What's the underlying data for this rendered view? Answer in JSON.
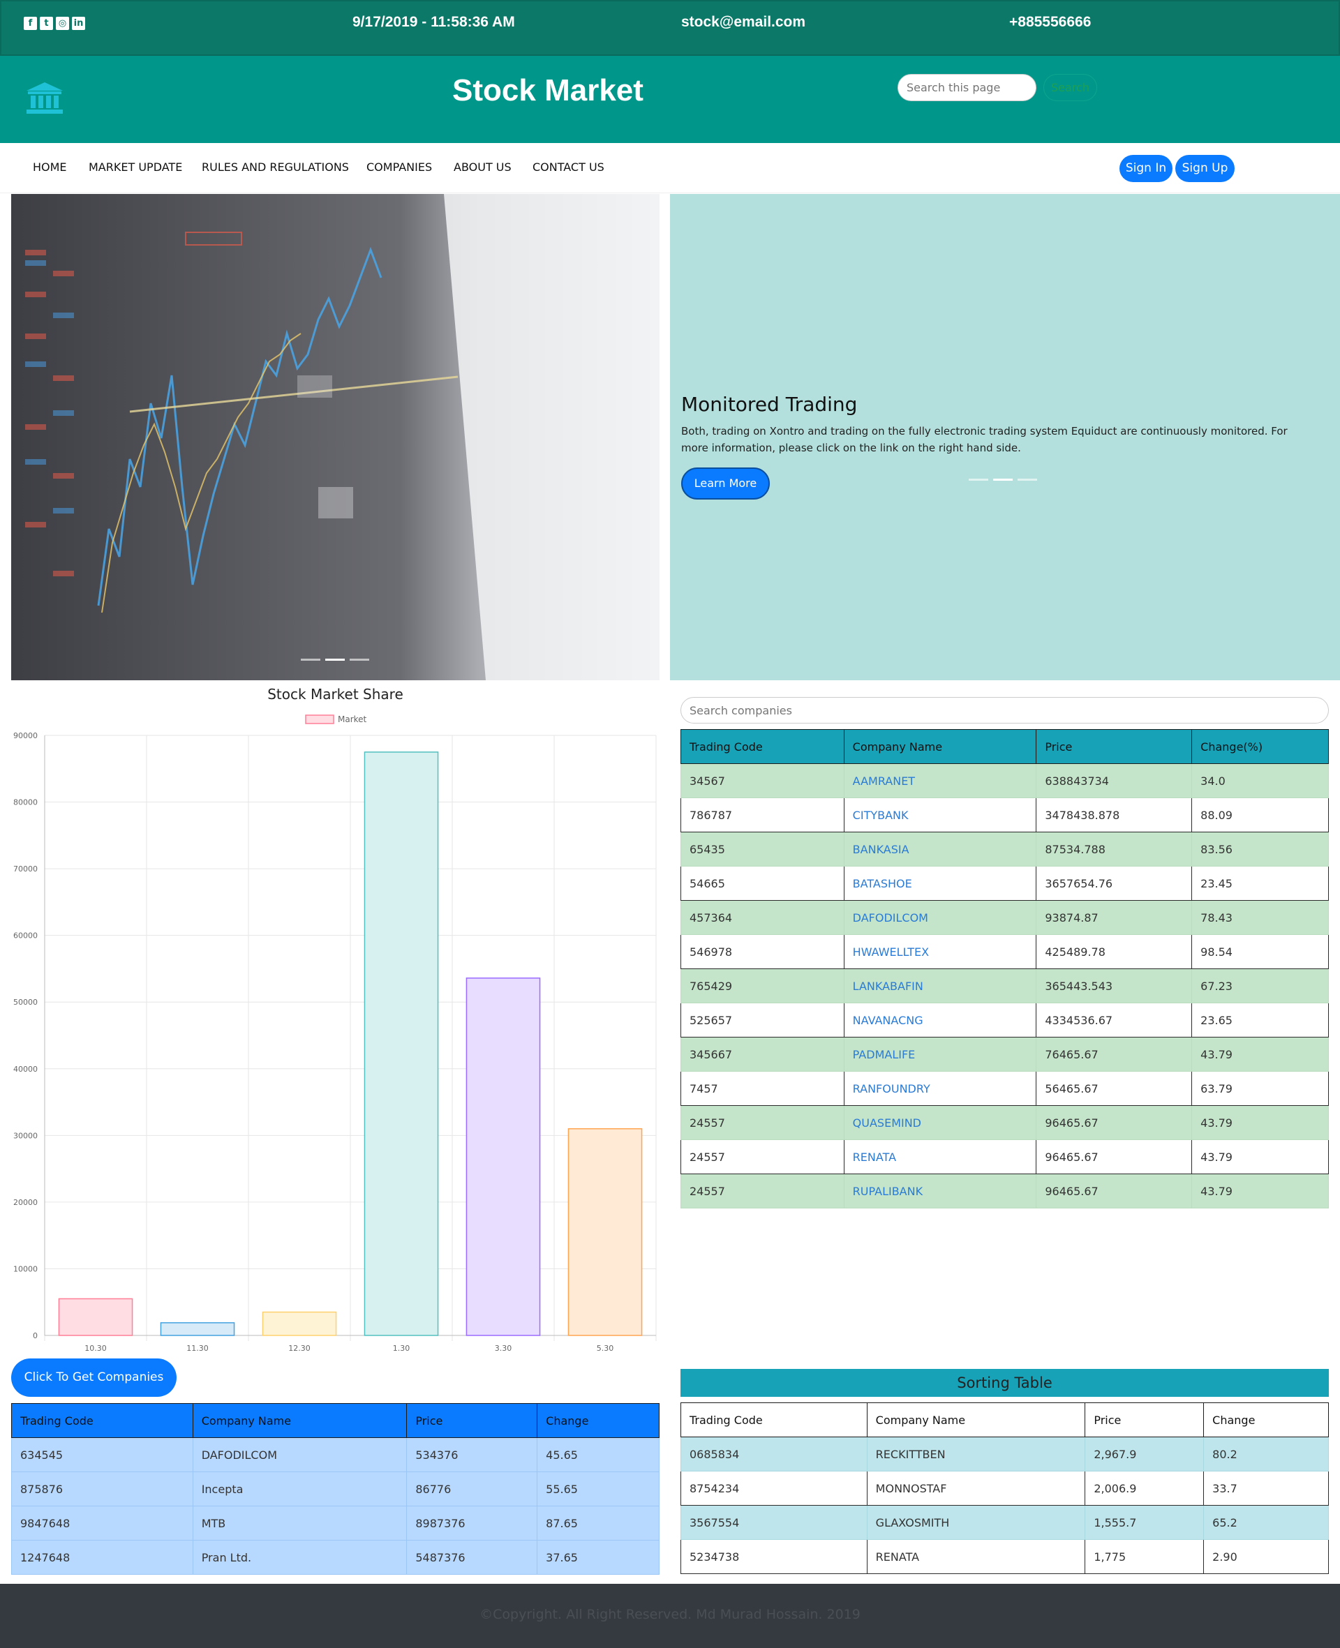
{
  "topbar": {
    "social_icons": [
      "facebook-icon",
      "twitter-icon",
      "instagram-icon",
      "linkedin-icon"
    ],
    "datetime": "9/17/2019 - 11:58:36 AM",
    "email": "stock@email.com",
    "phone": "+885556666"
  },
  "header": {
    "logo_icon": "bank-icon",
    "title": "Stock Market",
    "search_placeholder": "Search this page",
    "search_button": "Search"
  },
  "nav": {
    "items": [
      "HOME",
      "MARKET UPDATE",
      "RULES AND REGULATIONS",
      "COMPANIES",
      "ABOUT US",
      "CONTACT US"
    ],
    "sign_in": "Sign In",
    "sign_up": "Sign Up"
  },
  "hero": {
    "title": "Monitored Trading",
    "text": "Both, trading on Xontro and trading on the fully electronic trading system Equiduct are continuously monitored. For more information, please click on the link on the right hand side.",
    "button": "Learn More"
  },
  "chart_data": {
    "type": "bar",
    "title": "Stock Market Share",
    "categories": [
      "10.30",
      "11.30",
      "12.30",
      "1.30",
      "3.30",
      "5.30"
    ],
    "series": [
      {
        "name": "Market",
        "values": [
          5500,
          1900,
          3500,
          87500,
          53600,
          31000
        ]
      }
    ],
    "ylim": [
      0,
      90000
    ],
    "yticks": [
      0,
      10000,
      20000,
      30000,
      40000,
      50000,
      60000,
      70000,
      80000,
      90000
    ],
    "grid": true,
    "legend": "top",
    "bar_fills": [
      "#ffdde3",
      "#d6eaf8",
      "#fff3d6",
      "#d7f1f1",
      "#e8ddff",
      "#ffead6"
    ],
    "bar_strokes": [
      "#ff7f97",
      "#45a2e0",
      "#ffd16e",
      "#52c0c0",
      "#9c6bff",
      "#ffa550"
    ]
  },
  "companies": {
    "search_placeholder": "Search companies",
    "headers": [
      "Trading Code",
      "Company Name",
      "Price",
      "Change(%)"
    ],
    "rows": [
      [
        "34567",
        "AAMRANET",
        "638843734",
        "34.0"
      ],
      [
        "786787",
        "CITYBANK",
        "3478438.878",
        "88.09"
      ],
      [
        "65435",
        "BANKASIA",
        "87534.788",
        "83.56"
      ],
      [
        "54665",
        "BATASHOE",
        "3657654.76",
        "23.45"
      ],
      [
        "457364",
        "DAFODILCOM",
        "93874.87",
        "78.43"
      ],
      [
        "546978",
        "HWAWELLTEX",
        "425489.78",
        "98.54"
      ],
      [
        "765429",
        "LANKABAFIN",
        "365443.543",
        "67.23"
      ],
      [
        "525657",
        "NAVANACNG",
        "4334536.67",
        "23.65"
      ],
      [
        "345667",
        "PADMALIFE",
        "76465.67",
        "43.79"
      ],
      [
        "7457",
        "RANFOUNDRY",
        "56465.67",
        "63.79"
      ],
      [
        "24557",
        "QUASEMIND",
        "96465.67",
        "43.79"
      ],
      [
        "24557",
        "RENATA",
        "96465.67",
        "43.79"
      ],
      [
        "24557",
        "RUPALIBANK",
        "96465.67",
        "43.79"
      ]
    ]
  },
  "get_companies": {
    "button": "Click To Get Companies",
    "headers": [
      "Trading Code",
      "Company Name",
      "Price",
      "Change"
    ],
    "rows": [
      [
        "634545",
        "DAFODILCOM",
        "534376",
        "45.65"
      ],
      [
        "875876",
        "Incepta",
        "86776",
        "55.65"
      ],
      [
        "9847648",
        "MTB",
        "8987376",
        "87.65"
      ],
      [
        "1247648",
        "Pran Ltd.",
        "5487376",
        "37.65"
      ]
    ]
  },
  "sorting": {
    "title": "Sorting Table",
    "headers": [
      "Trading Code",
      "Company Name",
      "Price",
      "Change"
    ],
    "rows": [
      [
        "0685834",
        "RECKITTBEN",
        "2,967.9",
        "80.2"
      ],
      [
        "8754234",
        "MONNOSTAF",
        "2,006.9",
        "33.7"
      ],
      [
        "3567554",
        "GLAXOSMITH",
        "1,555.7",
        "65.2"
      ],
      [
        "5234738",
        "RENATA",
        "1,775",
        "2.90"
      ]
    ]
  },
  "footer": {
    "text": "©Copyright. All Right Reserved. Md Murad Hossain. 2019"
  }
}
